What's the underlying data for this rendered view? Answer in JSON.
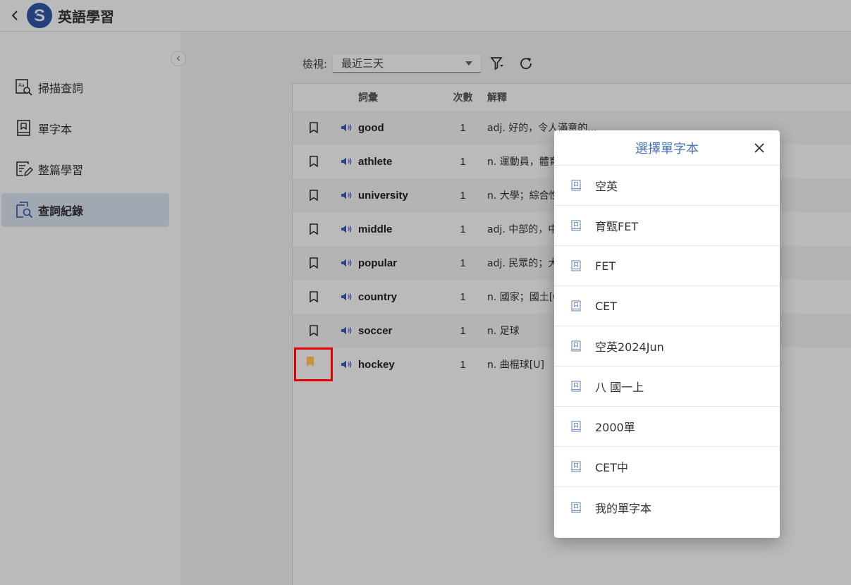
{
  "app": {
    "title": "英語學習"
  },
  "sidebar": {
    "items": [
      {
        "label": "掃描查詞",
        "icon": "scan-dictionary-icon"
      },
      {
        "label": "單字本",
        "icon": "wordbook-icon"
      },
      {
        "label": "整篇學習",
        "icon": "article-edit-icon"
      },
      {
        "label": "查詞紀錄",
        "icon": "lookup-history-icon",
        "active": true
      }
    ]
  },
  "toolbar": {
    "view_label": "檢視:",
    "view_value": "最近三天"
  },
  "table": {
    "headers": {
      "word": "詞彙",
      "count": "次數",
      "definition": "解釋"
    },
    "rows": [
      {
        "word": "good",
        "count": "1",
        "definition": "adj. 好的，令人滿意的..."
      },
      {
        "word": "athlete",
        "count": "1",
        "definition": "n. 運動員，體育..."
      },
      {
        "word": "university",
        "count": "1",
        "definition": "n. 大學；綜合性..."
      },
      {
        "word": "middle",
        "count": "1",
        "definition": "adj. 中部的，中..."
      },
      {
        "word": "popular",
        "count": "1",
        "definition": "adj. 民眾的；大..."
      },
      {
        "word": "country",
        "count": "1",
        "definition": "n. 國家；國土[C..."
      },
      {
        "word": "soccer",
        "count": "1",
        "definition": "n. 足球"
      },
      {
        "word": "hockey",
        "count": "1",
        "definition": "n. 曲棍球[U]",
        "bookmarked": true
      }
    ]
  },
  "dialog": {
    "title": "選擇單字本",
    "items": [
      "空英",
      "育甄FET",
      "FET",
      "CET",
      "空英2024Jun",
      "八 國一上",
      "2000單",
      "CET中",
      "我的單字本"
    ]
  },
  "colors": {
    "accent": "#2f5aa8",
    "bookmark_active": "#c8923c",
    "speaker": "#3a5fb0",
    "dialog_title": "#4a74b5",
    "highlight": "#e00000"
  }
}
